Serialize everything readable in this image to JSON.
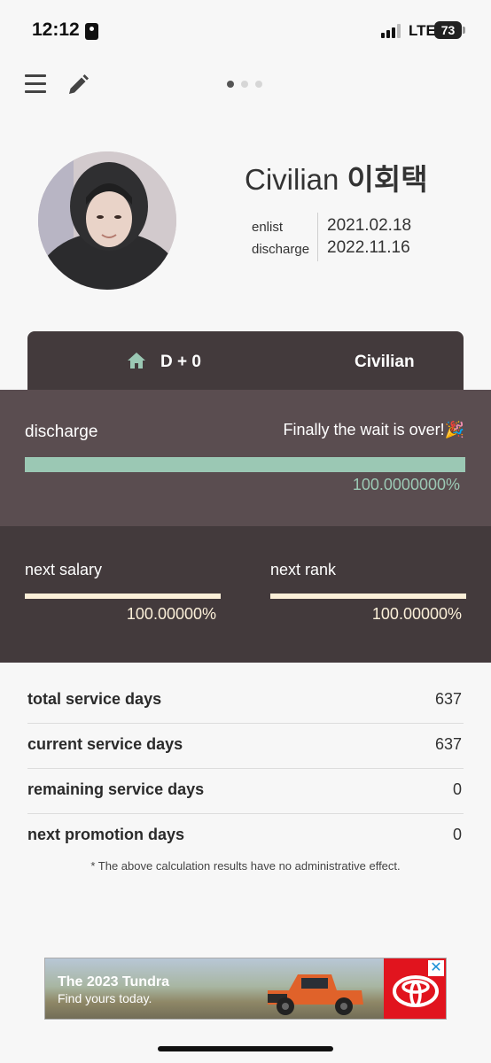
{
  "status_bar": {
    "time": "12:12",
    "network": "LTE",
    "battery": "73"
  },
  "topbar": {
    "menu_icon": "hamburger-menu-icon",
    "edit_icon": "pencil-icon",
    "pages": 3,
    "active_page": 1
  },
  "profile": {
    "name_prefix": "Civilian",
    "name_korean": "이회택",
    "enlist_label": "enlist",
    "discharge_label": "discharge",
    "enlist_date": "2021.02.18",
    "discharge_date": "2022.11.16"
  },
  "tabs": {
    "home_icon": "home-icon",
    "dday": "D + 0",
    "rank": "Civilian"
  },
  "discharge": {
    "label": "discharge",
    "message": "Finally the wait is over!🎉",
    "progress": 100,
    "progress_text": "100.0000000%"
  },
  "next": {
    "salary_label": "next salary",
    "salary_progress": 100,
    "salary_text": "100.00000%",
    "rank_label": "next rank",
    "rank_progress": 100,
    "rank_text": "100.00000%"
  },
  "stats": [
    {
      "label": "total service days",
      "value": "637"
    },
    {
      "label": "current service days",
      "value": "637"
    },
    {
      "label": "remaining service days",
      "value": "0"
    },
    {
      "label": "next promotion days",
      "value": "0"
    }
  ],
  "disclaimer": "* The above calculation results have no administrative effect.",
  "ad": {
    "title": "The 2023 Tundra",
    "subtitle": "Find yours today.",
    "close_icon": "close-icon",
    "brand_color": "#e1141e"
  },
  "colors": {
    "accent_green": "#9bc8b4",
    "dark_brown": "#433a3c",
    "mid_brown": "#5a4d50",
    "cream": "#fbefd8"
  }
}
